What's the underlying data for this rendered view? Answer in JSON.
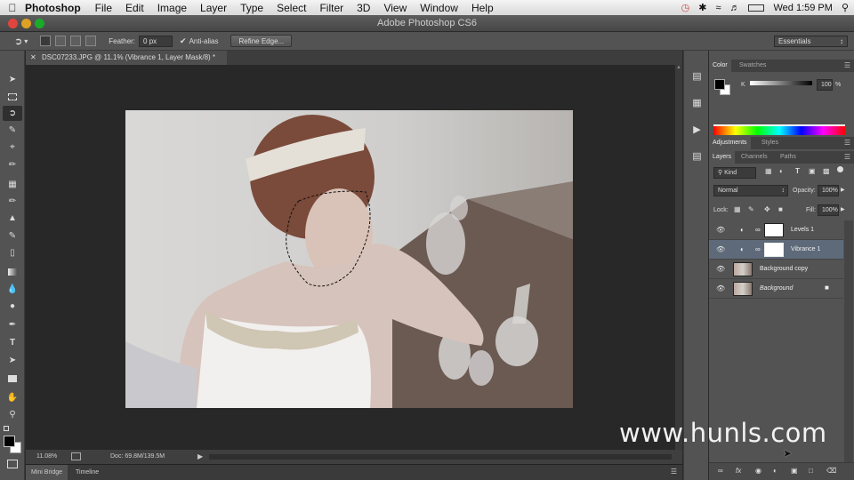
{
  "menubar": {
    "app_name": "Photoshop",
    "items": [
      "File",
      "Edit",
      "Image",
      "Layer",
      "Type",
      "Select",
      "Filter",
      "3D",
      "View",
      "Window",
      "Help"
    ],
    "clock": "Wed 1:59 PM"
  },
  "window": {
    "title": "Adobe Photoshop CS6"
  },
  "options_bar": {
    "feather_label": "Feather:",
    "feather_value": "0 px",
    "anti_alias_label": "Anti-alias",
    "anti_alias_checked": true,
    "refine_edge_label": "Refine Edge...",
    "workspace": "Essentials"
  },
  "document": {
    "tab_title": "DSC07233.JPG @ 11.1% (Vibrance 1, Layer Mask/8) *",
    "zoom": "11.08%",
    "doc_info": "Doc: 69.8M/139.5M"
  },
  "bottom_tabs": [
    "Mini Bridge",
    "Timeline"
  ],
  "color_panel": {
    "tabs": [
      "Color",
      "Swatches"
    ],
    "channel_label": "K",
    "value": "100",
    "unit": "%"
  },
  "adjustments_panel": {
    "tabs": [
      "Adjustments",
      "Styles"
    ]
  },
  "layers_panel": {
    "tabs": [
      "Layers",
      "Channels",
      "Paths"
    ],
    "filter_label": "Kind",
    "blend_mode": "Normal",
    "opacity_label": "Opacity:",
    "opacity_value": "100%",
    "lock_label": "Lock:",
    "fill_label": "Fill:",
    "fill_value": "100%",
    "layers": [
      {
        "name": "Levels 1",
        "type": "adjustment",
        "selected": false
      },
      {
        "name": "Vibrance 1",
        "type": "adjustment",
        "selected": true
      },
      {
        "name": "Background copy",
        "type": "pixel",
        "selected": false
      },
      {
        "name": "Background",
        "type": "pixel",
        "selected": false,
        "locked": true
      }
    ]
  },
  "watermark": "www.hunls.com",
  "colors": {
    "panel_bg": "#535353",
    "canvas_bg": "#282828",
    "selection_blue": "#5e6a7a"
  }
}
